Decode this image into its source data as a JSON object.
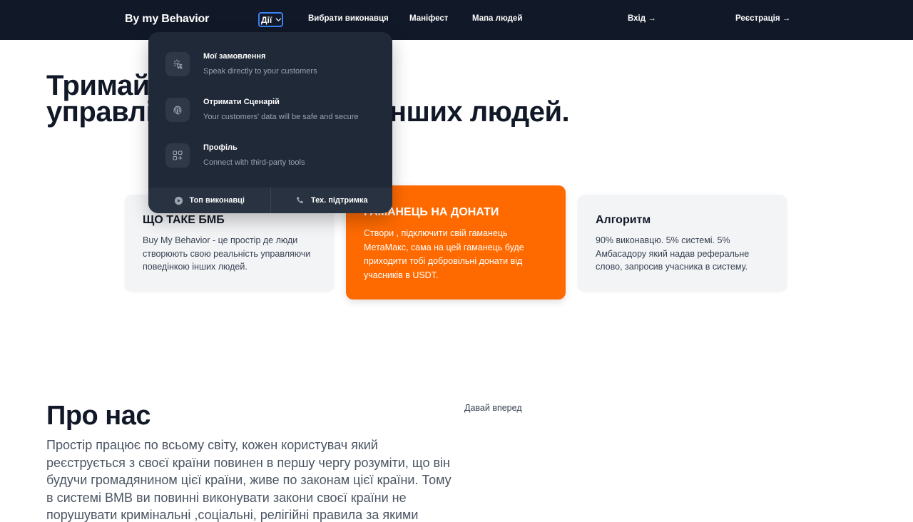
{
  "nav": {
    "brand": "By my Behavior",
    "actions_label": "Дії",
    "links": [
      "Вибрати виконавця",
      "Маніфест",
      "Мапа людей"
    ],
    "login": "Вхід →",
    "register": "Реєстрація →"
  },
  "dropdown": {
    "items": [
      {
        "icon": "cursor-click-icon",
        "title": "Мої замовлення",
        "subtitle": "Speak directly to your customers"
      },
      {
        "icon": "fingerprint-icon",
        "title": "Отримати Сценарій",
        "subtitle": "Your customers' data will be safe and secure"
      },
      {
        "icon": "squares-plus-icon",
        "title": "Профіль",
        "subtitle": "Connect with third-party tools"
      }
    ],
    "footer": [
      {
        "icon": "play-circle-icon",
        "label": "Топ виконавці"
      },
      {
        "icon": "phone-icon",
        "label": "Тех. підтримка"
      }
    ]
  },
  "hero": {
    "line1": "Тримай інструмент,",
    "line2": "управління поведінкою інших людей."
  },
  "cards": [
    {
      "title": "ЩО ТАКЕ БМБ",
      "body": "Buy My Behavior - це простір де люди створюють свою реальність управляючи поведінкою інших людей."
    },
    {
      "title": "ГАМАНЕЦЬ НА ДОНАТИ",
      "body": "Створи , підключити свій гаманець МетаМакс, сама на цей гаманець буде приходити тобі добровільні донати від учасників в USDT."
    },
    {
      "title": "Алгоритм",
      "body": "90% виконавцю. 5% системі. 5% Амбасадору який надав реферальне слово, запросив учасника в систему."
    }
  ],
  "about": {
    "title": "Про нас",
    "text": "Простір працює по всьому світу, кожен користувач який реєструється з своєї країни повинен в першу чергу розуміти, що він будучи громадянином цієї країни, живе по законам цієї країни. Тому в системі BMB ви повинні виконувати закони своєї країни не порушувати кримінальні ,соціальні, релігійні правила за якими",
    "link": "Давай вперед"
  },
  "colors": {
    "nav_bg": "#111827",
    "dropdown_bg": "#1f2937",
    "accent_orange": "#ff6a00",
    "focus_blue": "#3b82f6"
  }
}
